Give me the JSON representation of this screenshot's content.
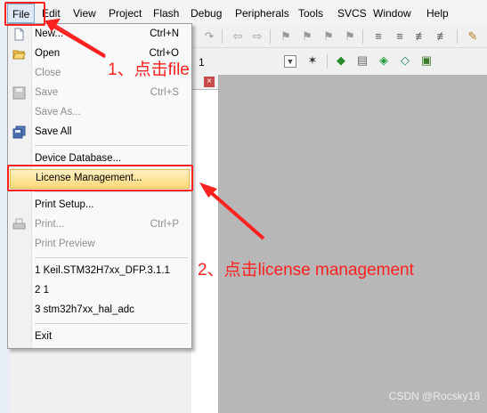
{
  "menubar": {
    "items": [
      "File",
      "Edit",
      "View",
      "Project",
      "Flash",
      "Debug",
      "Peripherals",
      "Tools",
      "SVCS",
      "Window",
      "Help"
    ]
  },
  "toolbar": {
    "target_combo": "1"
  },
  "file_menu": {
    "items": [
      {
        "label": "New...",
        "shortcut": "Ctrl+N",
        "icon": "new-file-icon"
      },
      {
        "label": "Open",
        "shortcut": "Ctrl+O",
        "icon": "open-folder-icon"
      },
      {
        "label": "Close",
        "shortcut": "",
        "disabled": true
      },
      {
        "label": "Save",
        "shortcut": "Ctrl+S",
        "disabled": true,
        "icon": "save-icon"
      },
      {
        "label": "Save As...",
        "shortcut": "",
        "disabled": true
      },
      {
        "label": "Save All",
        "shortcut": "",
        "icon": "save-all-icon"
      },
      {
        "label": "Device Database...",
        "shortcut": ""
      },
      {
        "label": "License Management...",
        "shortcut": "",
        "highlighted": true
      },
      {
        "label": "Print Setup...",
        "shortcut": ""
      },
      {
        "label": "Print...",
        "shortcut": "Ctrl+P",
        "disabled": true,
        "icon": "print-icon"
      },
      {
        "label": "Print Preview",
        "shortcut": "",
        "disabled": true
      },
      {
        "label": "1 Keil.STM32H7xx_DFP.3.1.1",
        "shortcut": ""
      },
      {
        "label": "2 1",
        "shortcut": ""
      },
      {
        "label": "3 stm32h7xx_hal_adc",
        "shortcut": ""
      },
      {
        "label": "Exit",
        "shortcut": ""
      }
    ]
  },
  "annotations": {
    "step1": "1、点击file",
    "step2": "2、点击license management"
  },
  "colors": {
    "annotation_red": "#ff2020",
    "highlight": "#fbd978"
  },
  "watermark": "CSDN @Rocsky18"
}
